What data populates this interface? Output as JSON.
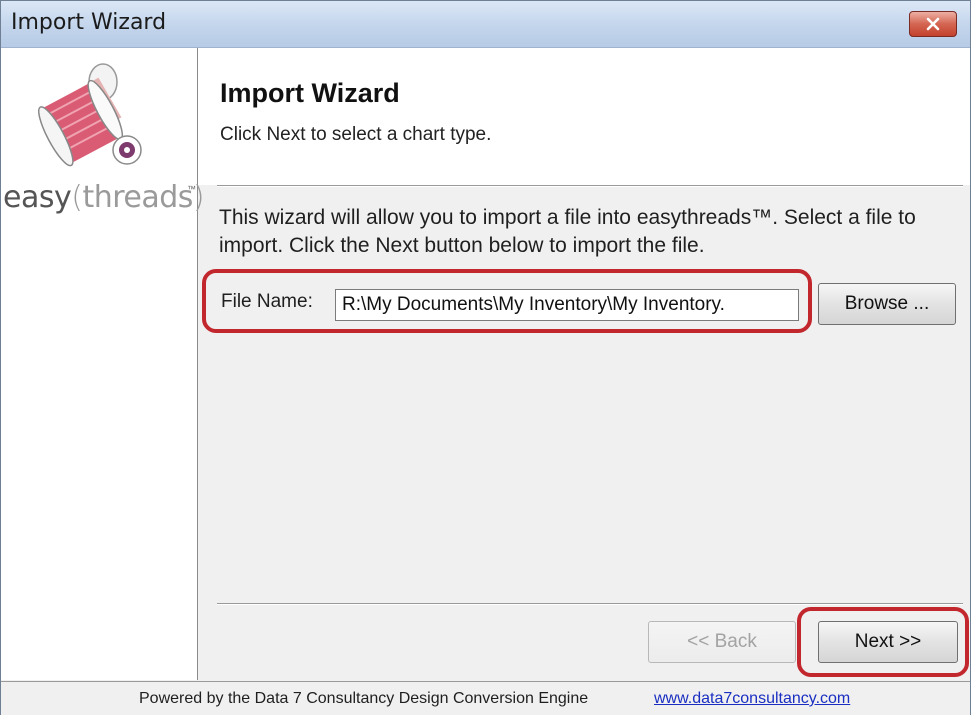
{
  "window": {
    "title": "Import Wizard"
  },
  "logo": {
    "word1": "easy",
    "word2": "threads",
    "tm": "™"
  },
  "header": {
    "title": "Import Wizard",
    "subtitle": "Click Next to select a chart type."
  },
  "body": {
    "description": "This wizard will allow you to import a file into easythreads™.  Select a file to import.  Click the Next button below to import the file.",
    "file_label": "File Name:",
    "file_value": "R:\\My Documents\\My Inventory\\My Inventory.",
    "browse_label": "Browse ..."
  },
  "nav": {
    "back_label": "<< Back",
    "next_label": "Next >>",
    "back_enabled": false
  },
  "footer": {
    "powered_by": "Powered by the Data 7 Consultancy Design Conversion Engine",
    "link": "www.data7consultancy.com"
  },
  "colors": {
    "highlight_ring": "#c1272d",
    "link": "#1a2fc2",
    "close_button": "#c3412d"
  }
}
